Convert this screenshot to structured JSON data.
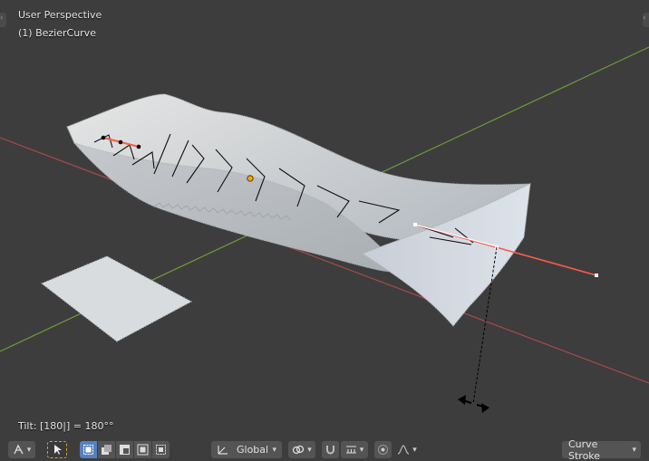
{
  "viewport": {
    "view_name": "User Perspective",
    "object_name": "(1) BezierCurve",
    "status_text": "Tilt: [180|] = 180°°"
  },
  "toolbar": {
    "orientation_label": "Global",
    "mode_label": "Curve Stroke",
    "icons": [
      "snap-menu-icon",
      "select-tool-icon",
      "select-box-new-icon",
      "select-box-extend-icon",
      "select-box-subtract-icon",
      "select-box-invert-icon",
      "select-box-intersect-icon",
      "transform-orientation-icon",
      "pivot-link-icon",
      "snap-magnet-icon",
      "snap-increment-icon",
      "proportional-edit-icon",
      "falloff-curve-icon"
    ]
  },
  "colors": {
    "background": "#3d3d3d",
    "x_axis": "#a94a4f",
    "y_axis": "#6f9a3a",
    "active_tilt_line": "#ff5a4a",
    "origin": "#ffa500",
    "select_active": "#5680c2",
    "mesh_light": "#d6d9dc"
  }
}
